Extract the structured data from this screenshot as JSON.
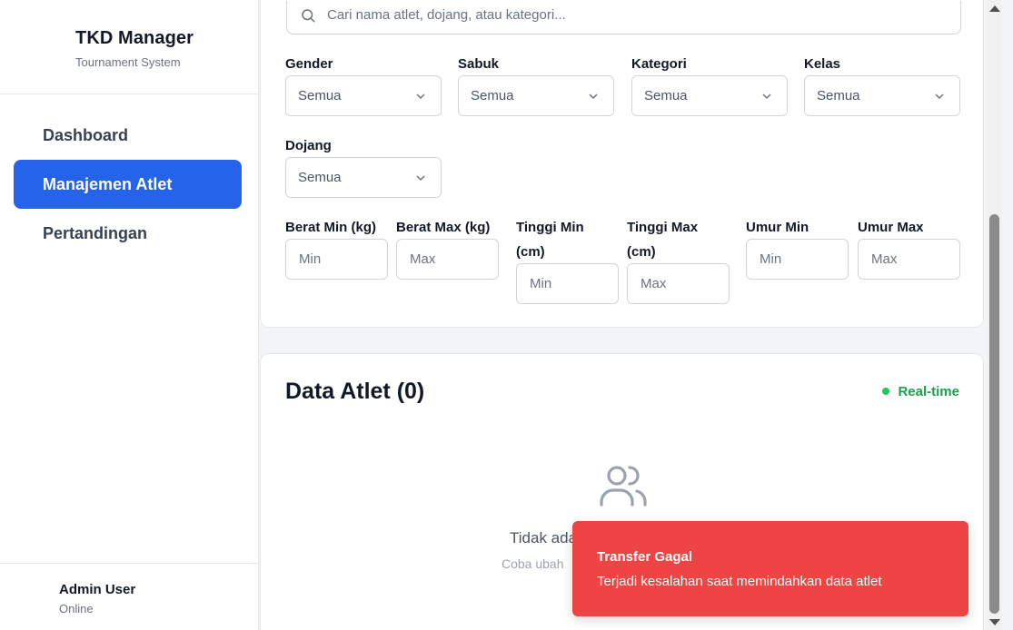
{
  "sidebar": {
    "brand_title": "TKD Manager",
    "brand_subtitle": "Tournament System",
    "items": [
      {
        "label": "Dashboard",
        "active": false
      },
      {
        "label": "Manajemen Atlet",
        "active": true
      },
      {
        "label": "Pertandingan",
        "active": false
      }
    ],
    "user": {
      "name": "Admin User",
      "status": "Online"
    }
  },
  "filters": {
    "search_placeholder": "Cari nama atlet, dojang, atau kategori...",
    "selects": [
      {
        "label": "Gender",
        "value": "Semua"
      },
      {
        "label": "Sabuk",
        "value": "Semua"
      },
      {
        "label": "Kategori",
        "value": "Semua"
      },
      {
        "label": "Kelas",
        "value": "Semua"
      },
      {
        "label": "Dojang",
        "value": "Semua"
      }
    ],
    "ranges": [
      {
        "label_line1": "Berat Min (kg)",
        "label_line2": "",
        "placeholder": "Min"
      },
      {
        "label_line1": "Berat Max (kg)",
        "label_line2": "",
        "placeholder": "Max"
      },
      {
        "label_line1": "Tinggi Min",
        "label_line2": "(cm)",
        "placeholder": "Min"
      },
      {
        "label_line1": "Tinggi Max",
        "label_line2": "(cm)",
        "placeholder": "Max"
      },
      {
        "label_line1": "Umur Min",
        "label_line2": "",
        "placeholder": "Min"
      },
      {
        "label_line1": "Umur Max",
        "label_line2": "",
        "placeholder": "Max"
      }
    ]
  },
  "data_section": {
    "title": "Data Atlet (0)",
    "realtime_label": "Real-time",
    "empty_title": "Tidak ada",
    "empty_subtitle": "Coba ubah"
  },
  "toast": {
    "title": "Transfer Gagal",
    "message": "Terjadi kesalahan saat memindahkan data atlet"
  },
  "colors": {
    "accent": "#2563eb",
    "success": "#16a34a",
    "error": "#ef4444"
  }
}
